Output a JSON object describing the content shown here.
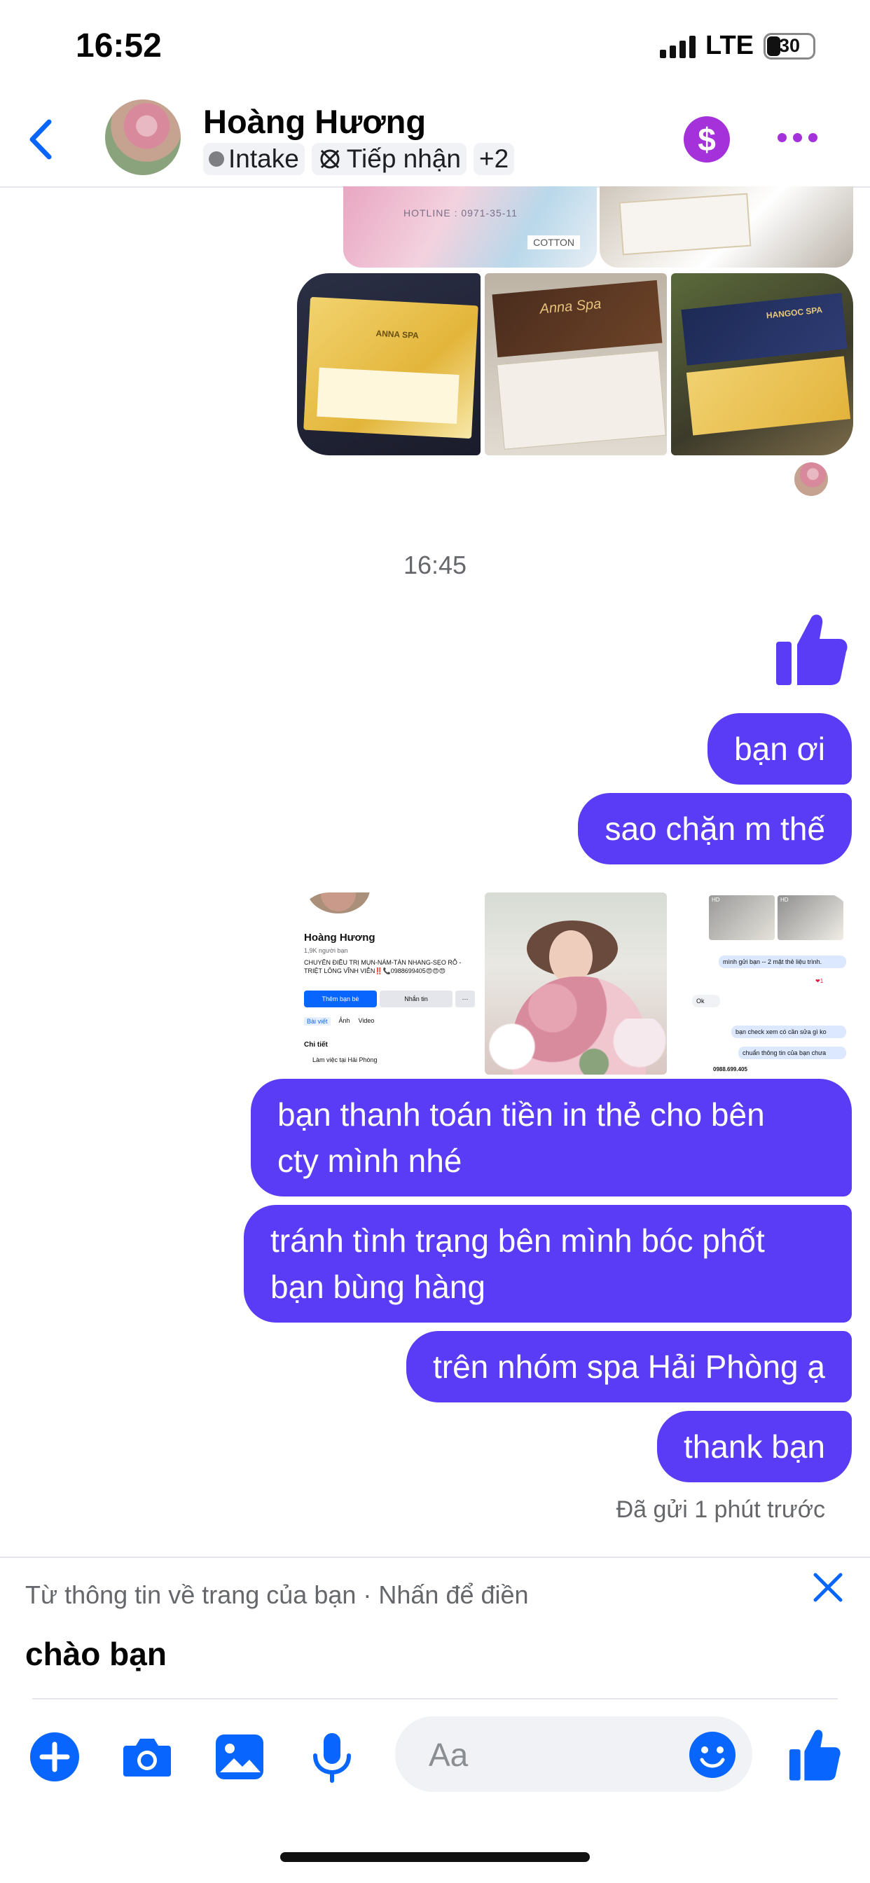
{
  "status_bar": {
    "time": "16:52",
    "network": "LTE",
    "battery": "30"
  },
  "header": {
    "contact_name": "Hoàng Hương",
    "tags": [
      "Intake",
      "Tiếp nhận",
      "+2"
    ]
  },
  "photo_cards": {
    "brand_1": "ANNA SPA",
    "brand_2": "Anna Spa",
    "brand_3": "HANGOC SPA",
    "brand_4": "COTTON",
    "hotline": "HOTLINE : 0971-35-11"
  },
  "profile_card": {
    "name": "Hoàng Hương",
    "friends": "1,9K người bạn",
    "bio": "CHUYÊN ĐIỀU TRỊ MỤN-NÁM-TÀN NHANG-SẸO RỖ -TRIỆT LÔNG VĨNH VIỄN‼️📞0988699405😍😍😍",
    "add_friend": "Thêm bạn bè",
    "message": "Nhắn tin",
    "more": "···",
    "tabs": [
      "Bài viết",
      "Ảnh",
      "Video"
    ],
    "details_title": "Chi tiết",
    "work": "Làm việc tại Hải Phòng"
  },
  "chat_screenshot": {
    "msg1": "mình gửi bạn -- 2 mặt thẻ liệu trình.",
    "reply": "Ok",
    "msg2": "bạn check xem có cần sửa gì ko",
    "msg3": "chuẩn thông tin của bạn chưa",
    "phone": "0988.699.405",
    "hd": "HD",
    "reaction": "❤1"
  },
  "timestamp": "16:45",
  "messages": [
    "bạn ơi",
    "sao chặn m thế",
    "bạn thanh toán tiền in thẻ cho bên\ncty mình nhé",
    "tránh tình trạng bên mình bóc phốt\nbạn bùng hàng",
    "trên nhóm spa Hải Phòng ạ",
    "thank bạn"
  ],
  "sent_status": "Đã gửi 1 phút trước",
  "suggestion": {
    "hint": "Từ thông tin về trang của bạn · Nhấn để điền",
    "text": "chào bạn"
  },
  "composer": {
    "placeholder": "Aa"
  },
  "colors": {
    "accent": "#5a3cf6",
    "icon_blue": "#0866ff",
    "pay_purple": "#a431d9"
  }
}
